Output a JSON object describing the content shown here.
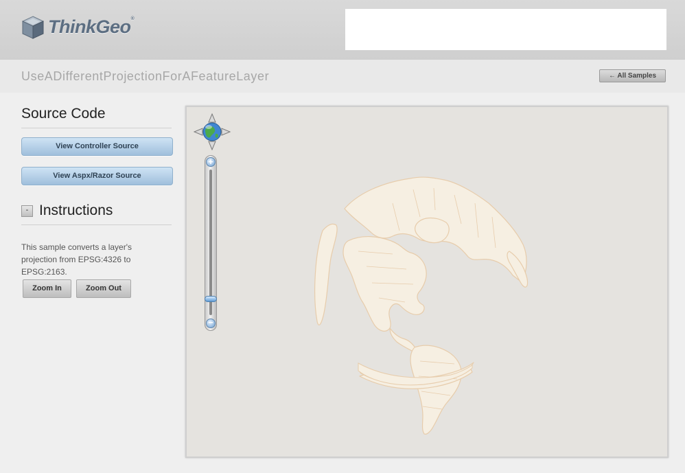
{
  "header": {
    "logo_text": "ThinkGeo",
    "logo_mark": "®"
  },
  "page": {
    "title": "UseADifferentProjectionForAFeatureLayer"
  },
  "nav": {
    "all_samples_label": "← All Samples"
  },
  "source_code": {
    "title": "Source Code",
    "controller_button": "View Controller Source",
    "aspx_button": "View Aspx/Razor Source"
  },
  "instructions": {
    "title": "Instructions",
    "toggle": "-",
    "description": "This sample converts a layer's projection from EPSG:4326 to EPSG:2163.",
    "zoom_in_label": "Zoom In",
    "zoom_out_label": "Zoom Out"
  },
  "map": {
    "zoom_level_fraction": 0.08,
    "land_fill": "#f6efe2",
    "land_stroke": "#e7ccab",
    "background": "#e5e3df",
    "icons": [
      "pan-globe-icon",
      "zoom-in-icon",
      "zoom-out-icon"
    ]
  }
}
